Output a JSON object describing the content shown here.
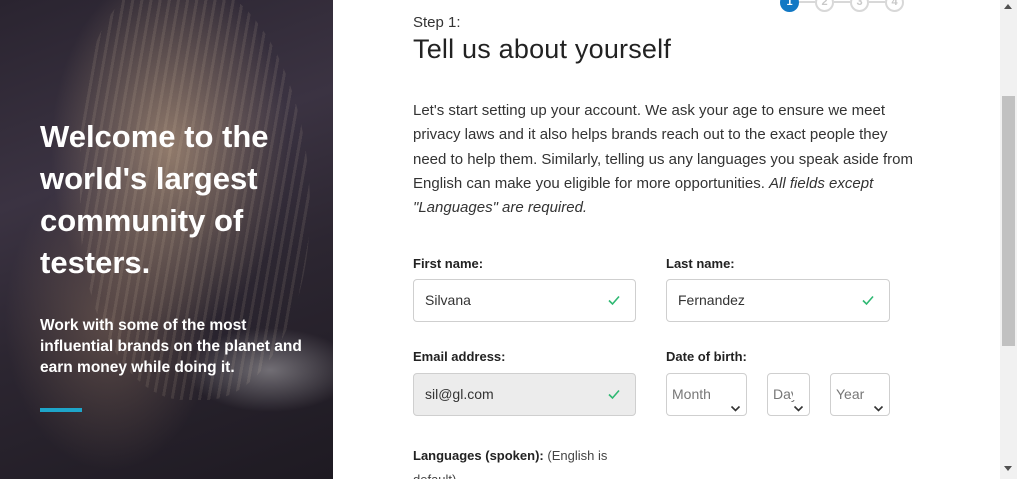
{
  "hero": {
    "title": "Welcome to the world's largest community of testers.",
    "subtitle": "Work with some of the most influential brands on the planet and earn money while doing it.",
    "accent_color": "#1ea5c9"
  },
  "step": {
    "label": "Step 1:",
    "title": "Tell us about yourself",
    "progress": {
      "current": 1,
      "steps": [
        "1",
        "2",
        "3",
        "4"
      ],
      "active_color": "#1278c4"
    }
  },
  "intro": {
    "text": "Let's start setting up your account. We ask your age to ensure we meet privacy laws and it also helps brands reach out to the exact people they need to help them. Similarly, telling us any languages you speak aside from English can make you eligible for more opportunities.",
    "emphasis": "All fields except \"Languages\" are required."
  },
  "form": {
    "first_name": {
      "label": "First name:",
      "value": "Silvana",
      "valid_icon": "check-icon"
    },
    "last_name": {
      "label": "Last name:",
      "value": "Fernandez",
      "valid_icon": "check-icon"
    },
    "email": {
      "label": "Email address:",
      "value": "sil@gl.com",
      "valid_icon": "check-icon",
      "disabled": true
    },
    "dob": {
      "label": "Date of birth:",
      "month": "Month",
      "day": "Day",
      "year": "Year"
    },
    "languages": {
      "label": "Languages (spoken):",
      "note": "(English is default)"
    },
    "valid_color": "#2eb872"
  }
}
